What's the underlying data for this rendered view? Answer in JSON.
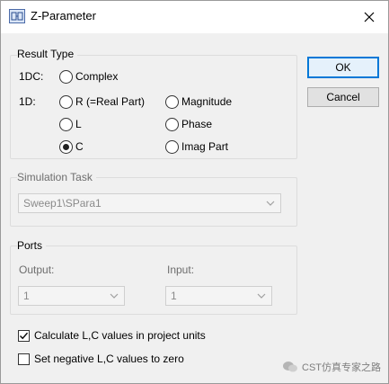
{
  "window": {
    "title": "Z-Parameter",
    "app_icon": "z-parameter-app-icon",
    "close_icon": "close-icon"
  },
  "result_type": {
    "group_label": "Result Type",
    "row_1dc_label": "1DC:",
    "row_1d_label": "1D:",
    "options": {
      "complex": {
        "label": "Complex",
        "checked": false
      },
      "real": {
        "label": "R (=Real Part)",
        "checked": false
      },
      "magnitude": {
        "label": "Magnitude",
        "checked": false
      },
      "l": {
        "label": "L",
        "checked": false
      },
      "phase": {
        "label": "Phase",
        "checked": false
      },
      "c": {
        "label": "C",
        "checked": true
      },
      "imag": {
        "label": "Imag Part",
        "checked": false
      }
    }
  },
  "simulation_task": {
    "group_label": "Simulation Task",
    "selected": "Sweep1\\SPara1",
    "enabled": false
  },
  "ports": {
    "group_label": "Ports",
    "output_label": "Output:",
    "output_selected": "1",
    "input_label": "Input:",
    "input_selected": "1",
    "enabled": false
  },
  "options": {
    "calc_lc": {
      "label": "Calculate L,C values in project units",
      "checked": true
    },
    "negative_zero": {
      "label": "Set negative L,C values to zero",
      "checked": false
    }
  },
  "buttons": {
    "ok": "OK",
    "cancel": "Cancel"
  },
  "watermark": {
    "text": "CST仿真专家之路",
    "icon": "wechat-icon"
  },
  "colors": {
    "accent": "#0078d7",
    "disabled_text": "#8a8a8a",
    "dialog_bg": "#f0f0f0"
  }
}
